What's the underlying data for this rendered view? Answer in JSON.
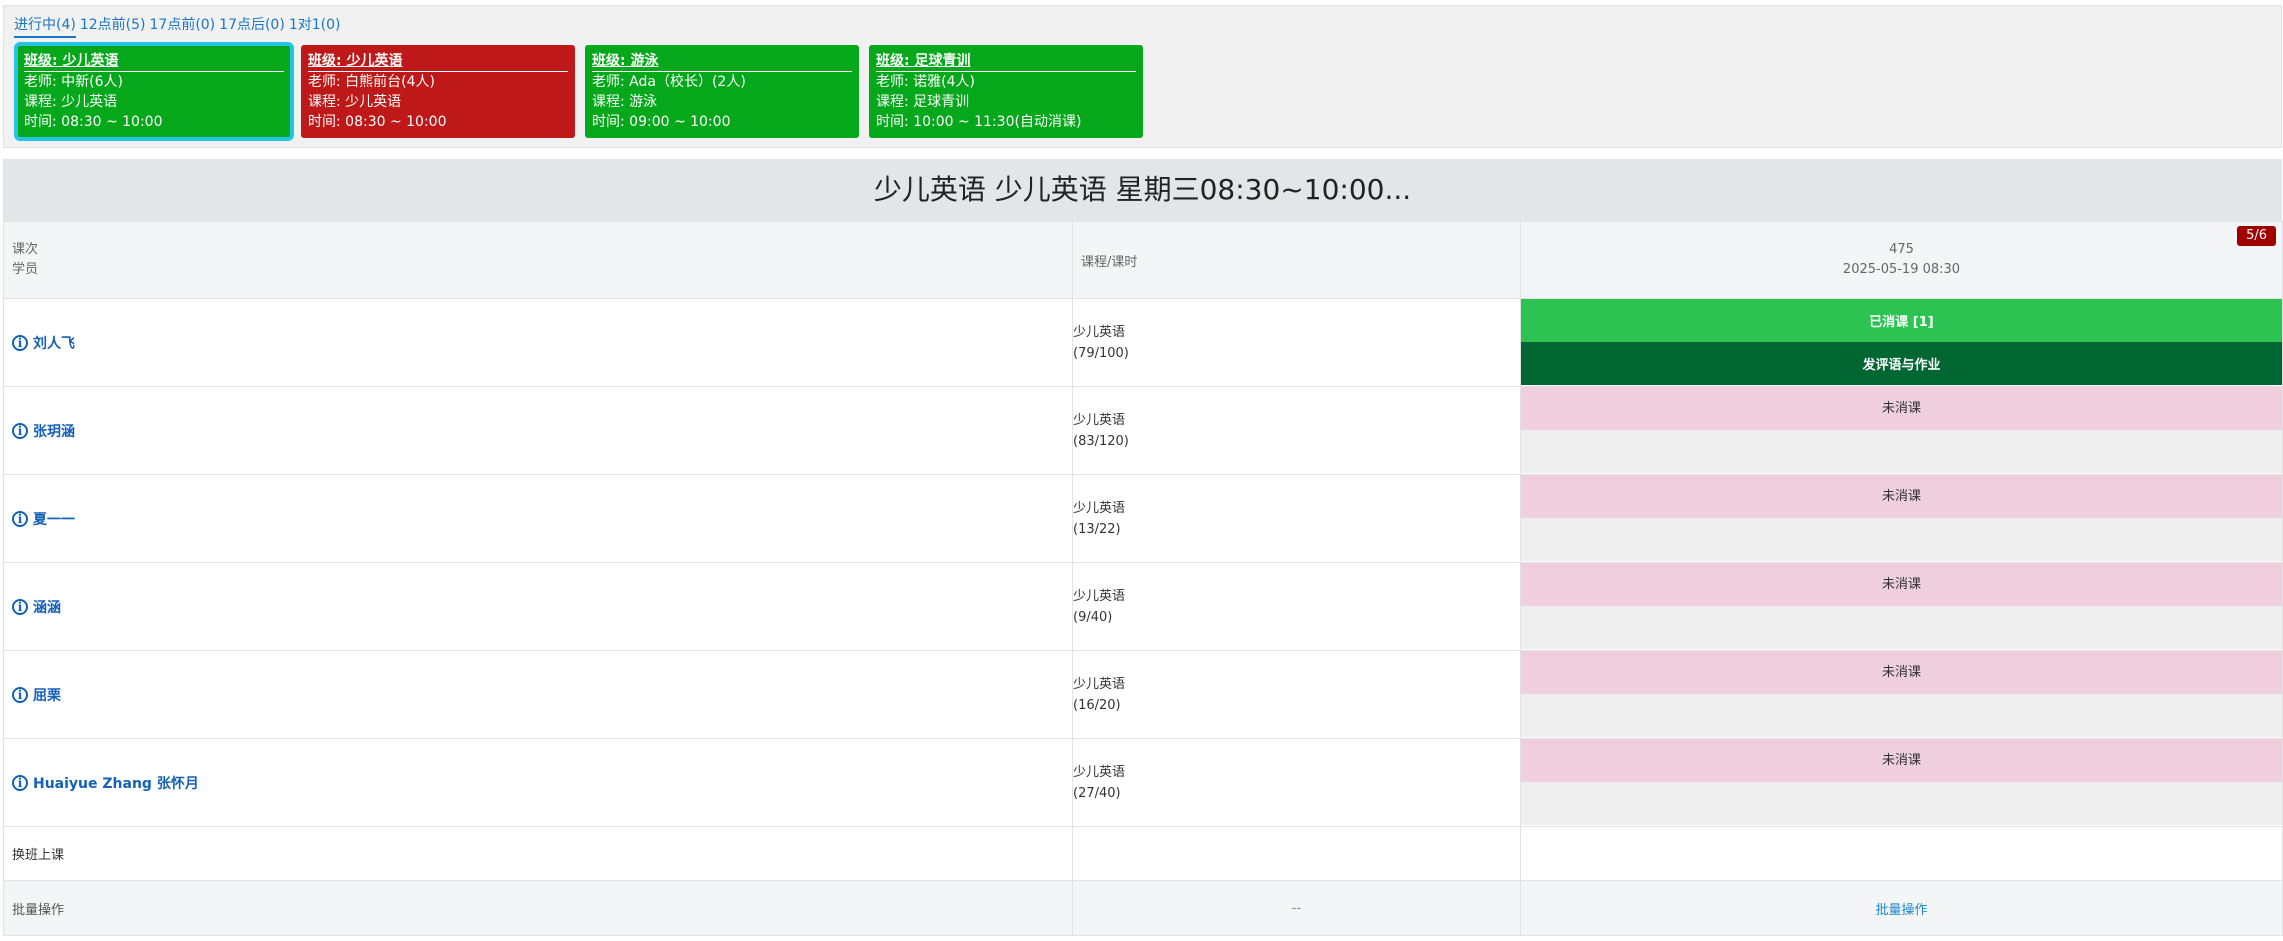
{
  "tabs": [
    {
      "label": "进行中(4)"
    },
    {
      "label": "12点前(5)"
    },
    {
      "label": "17点前(0)"
    },
    {
      "label": "17点后(0)"
    },
    {
      "label": "1对1(0)"
    }
  ],
  "cards": [
    {
      "title": "班级: 少儿英语",
      "teacher": "老师: 中新(6人)",
      "course": "课程: 少儿英语",
      "time": "时间: 08:30 ~ 10:00",
      "color": "#06a81b"
    },
    {
      "title": "班级: 少儿英语",
      "teacher": "老师: 白熊前台(4人)",
      "course": "课程: 少儿英语",
      "time": "时间: 08:30 ~ 10:00",
      "color": "#bf1818"
    },
    {
      "title": "班级: 游泳",
      "teacher": "老师: Ada（校长）(2人)",
      "course": "课程: 游泳",
      "time": "时间: 09:00 ~ 10:00",
      "color": "#06a81b"
    },
    {
      "title": "班级: 足球青训",
      "teacher": "老师: 诺雅(4人)",
      "course": "课程: 足球青训",
      "time": "时间: 10:00 ~ 11:30(自动消课)",
      "color": "#06a81b"
    }
  ],
  "session_title": "少儿英语 少儿英语 星期三08:30~10:00...",
  "header": {
    "col1_line1": "课次",
    "col1_line2": "学员",
    "col2": "课程/课时",
    "lesson_no": "475",
    "lesson_time": "2025-05-19 08:30",
    "badge": "5/6"
  },
  "students": [
    {
      "name": "刘人飞",
      "course": "少儿英语",
      "hours": "(79/100)",
      "status": "已消课 [1]",
      "action": "发评语与作业"
    },
    {
      "name": "张玥涵",
      "course": "少儿英语",
      "hours": "(83/120)",
      "status": "未消课",
      "action": ""
    },
    {
      "name": "夏一一",
      "course": "少儿英语",
      "hours": "(13/22)",
      "status": "未消课",
      "action": ""
    },
    {
      "name": "涵涵",
      "course": "少儿英语",
      "hours": "(9/40)",
      "status": "未消课",
      "action": ""
    },
    {
      "name": "屈栗",
      "course": "少儿英语",
      "hours": "(16/20)",
      "status": "未消课",
      "action": ""
    },
    {
      "name": "Huaiyue Zhang 张怀月",
      "course": "少儿英语",
      "hours": "(27/40)",
      "status": "未消课",
      "action": ""
    }
  ],
  "change_class": "换班上课",
  "batch": {
    "label": "批量操作",
    "dash": "--",
    "link": "批量操作"
  },
  "colors": {
    "done": "#2cc352",
    "action": "#006632",
    "pending": "#f0cfdc",
    "link": "#1560b8"
  }
}
